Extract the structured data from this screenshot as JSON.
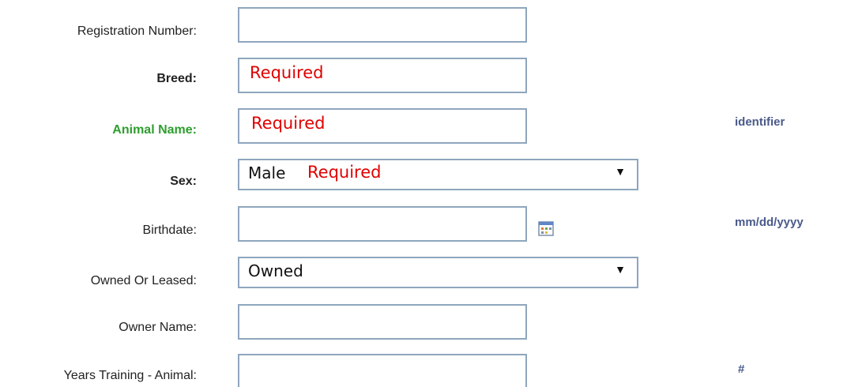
{
  "form": {
    "registration_number": {
      "label": "Registration Number:",
      "value": ""
    },
    "breed": {
      "label": "Breed:",
      "value": "",
      "annotation": "Required"
    },
    "animal_name": {
      "label": "Animal Name:",
      "value": "",
      "annotation": "Required",
      "hint": "identifier",
      "label_color": "#2e9e2e"
    },
    "sex": {
      "label": "Sex:",
      "selected": "Male",
      "annotation": "Required"
    },
    "birthdate": {
      "label": "Birthdate:",
      "value": "",
      "hint": "mm/dd/yyyy",
      "icon": "calendar-icon"
    },
    "owned_or_leased": {
      "label": "Owned Or Leased:",
      "selected": "Owned"
    },
    "owner_name": {
      "label": "Owner Name:",
      "value": ""
    },
    "years_training": {
      "label": "Years Training - Animal:",
      "value": "",
      "hint": "#"
    }
  },
  "colors": {
    "required_text": "#e00000",
    "hint_text": "#4a5a8a",
    "field_border": "#8fa6bd"
  }
}
